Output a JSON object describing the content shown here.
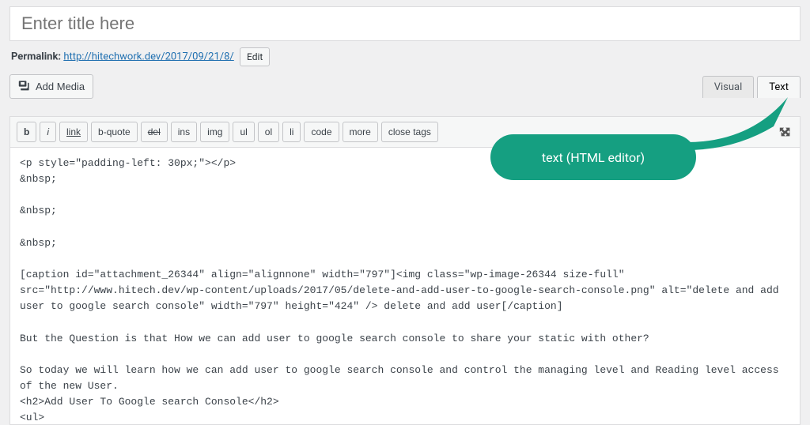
{
  "title_placeholder": "Enter title here",
  "permalink": {
    "label": "Permalink:",
    "url_text": "http://hitechwork.dev/2017/09/21/8/",
    "edit_label": "Edit"
  },
  "media_button_label": "Add Media",
  "tabs": {
    "visual": "Visual",
    "text": "Text"
  },
  "quicktags": [
    "b",
    "i",
    "link",
    "b-quote",
    "del",
    "ins",
    "img",
    "ul",
    "ol",
    "li",
    "code",
    "more",
    "close tags"
  ],
  "editor_content": "<p style=\"padding-left: 30px;\"></p>\n&nbsp;\n\n&nbsp;\n\n&nbsp;\n\n[caption id=\"attachment_26344\" align=\"alignnone\" width=\"797\"]<img class=\"wp-image-26344 size-full\" src=\"http://www.hitech.dev/wp-content/uploads/2017/05/delete-and-add-user-to-google-search-console.png\" alt=\"delete and add user to google search console\" width=\"797\" height=\"424\" /> delete and add user[/caption]\n\nBut the Question is that How we can add user to google search console to share your static with other?\n\nSo today we will learn how we can add user to google search console and control the managing level and Reading level access of the new User.\n<h2>Add User To Google search Console</h2>\n<ul>\n \t<li>Login your <a href=\"https://www.google.com/webmasters/tools/home?hl=en\" target=\"_blank\" rel=\"nofollow noopener",
  "callout_text": "text (HTML editor)"
}
